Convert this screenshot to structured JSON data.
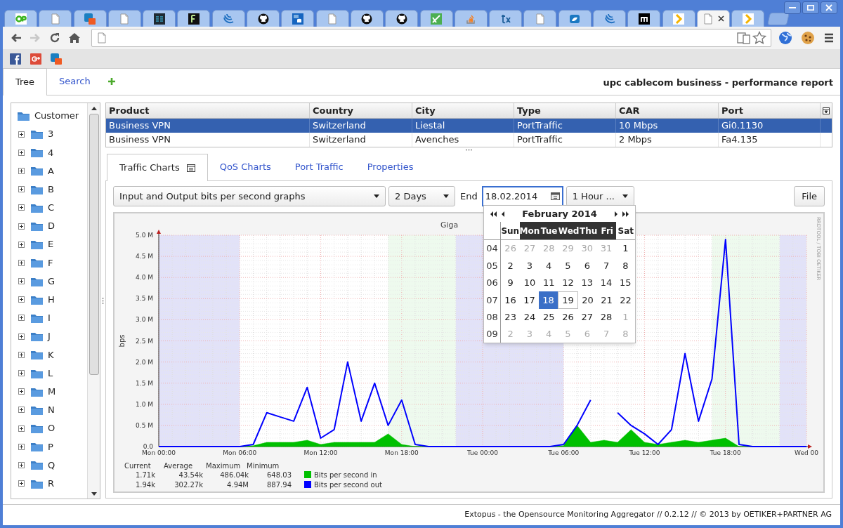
{
  "browser": {
    "tabs": [
      {
        "kind": "op",
        "selected": false
      },
      {
        "kind": "doc",
        "selected": false
      },
      {
        "kind": "z",
        "selected": false
      },
      {
        "kind": "doc",
        "selected": false
      },
      {
        "kind": "ss",
        "selected": false
      },
      {
        "kind": "f",
        "selected": false
      },
      {
        "kind": "jquery",
        "selected": false
      },
      {
        "kind": "github",
        "selected": false
      },
      {
        "kind": "db",
        "selected": false
      },
      {
        "kind": "doc",
        "selected": false
      },
      {
        "kind": "github",
        "selected": false
      },
      {
        "kind": "github",
        "selected": false
      },
      {
        "kind": "green",
        "selected": false
      },
      {
        "kind": "so",
        "selected": false
      },
      {
        "kind": "tx",
        "selected": false
      },
      {
        "kind": "doc",
        "selected": false
      },
      {
        "kind": "bird",
        "selected": false
      },
      {
        "kind": "jquery",
        "selected": false
      },
      {
        "kind": "m",
        "selected": false
      },
      {
        "kind": "arrow",
        "selected": false
      },
      {
        "kind": "doc",
        "selected": true
      },
      {
        "kind": "arrow",
        "selected": false
      }
    ],
    "nav_buttons": [
      {
        "kind": "back",
        "disabled": false
      },
      {
        "kind": "forward",
        "disabled": true
      },
      {
        "kind": "reload",
        "disabled": false
      },
      {
        "kind": "home",
        "disabled": false
      }
    ],
    "bookmarks": [
      {
        "kind": "facebook"
      },
      {
        "kind": "gplus"
      },
      {
        "kind": "z"
      }
    ]
  },
  "app": {
    "tabs": [
      {
        "label": "Tree",
        "selected": true
      },
      {
        "label": "Search",
        "selected": false
      }
    ],
    "title": "upc cablecom business - performance report",
    "tree": {
      "label": "Customer",
      "children": [
        {
          "label": "3",
          "expanded": false
        },
        {
          "label": "4",
          "expanded": false
        },
        {
          "label": "A",
          "expanded": false
        },
        {
          "label": "B",
          "expanded": false
        },
        {
          "label": "C",
          "expanded": false
        },
        {
          "label": "D",
          "expanded": false
        },
        {
          "label": "E",
          "expanded": false
        },
        {
          "label": "F",
          "expanded": false
        },
        {
          "label": "G",
          "expanded": false
        },
        {
          "label": "H",
          "expanded": false
        },
        {
          "label": "I",
          "expanded": false
        },
        {
          "label": "J",
          "expanded": false
        },
        {
          "label": "K",
          "expanded": false
        },
        {
          "label": "L",
          "expanded": false
        },
        {
          "label": "M",
          "expanded": false
        },
        {
          "label": "N",
          "expanded": false
        },
        {
          "label": "O",
          "expanded": false
        },
        {
          "label": "P",
          "expanded": false
        },
        {
          "label": "Q",
          "expanded": false
        },
        {
          "label": "R",
          "expanded": false
        }
      ]
    },
    "table": {
      "columns": [
        "Product",
        "Country",
        "City",
        "Type",
        "CAR",
        "Port"
      ],
      "rows": [
        {
          "cells": [
            "Business VPN",
            "Switzerland",
            "Liestal",
            "PortTraffic",
            "10 Mbps",
            "Gi0.1130"
          ],
          "selected": true
        },
        {
          "cells": [
            "Business VPN",
            "Switzerland",
            "Avenches",
            "PortTraffic",
            "2 Mbps",
            "Fa4.135"
          ],
          "selected": false
        }
      ]
    },
    "view_tabs": [
      {
        "label": "Traffic Charts",
        "selected": true
      },
      {
        "label": "QoS Charts",
        "selected": false
      },
      {
        "label": "Port Traffic",
        "selected": false
      },
      {
        "label": "Properties",
        "selected": false
      }
    ],
    "toolbar": {
      "graph_select": "Input and Output bits per second graphs",
      "range_select": "2 Days",
      "end_label": "End",
      "end_date": "18.02.2014",
      "step_select": "1 Hour ...",
      "file_button": "File"
    },
    "chart": {
      "credit": "RRDTOOL / TOBI OETIKER",
      "chart_data": {
        "type": "line",
        "title": "Giga",
        "ylabel": "bps",
        "grid": true,
        "legend": "bottom",
        "categories": [
          "Mon 00:00",
          null,
          null,
          null,
          null,
          null,
          "Mon 06:00",
          null,
          null,
          null,
          null,
          null,
          "Mon 12:00",
          null,
          null,
          null,
          null,
          null,
          "Mon 18:00",
          null,
          null,
          null,
          null,
          null,
          "Tue 00:00",
          null,
          null,
          null,
          null,
          null,
          "Tue 06:00",
          null,
          null,
          null,
          null,
          null,
          "Tue 12:00",
          null,
          null,
          null,
          null,
          null,
          "Tue 18:00",
          null,
          null,
          null,
          null,
          null,
          "Wed 00"
        ],
        "ylim": [
          0,
          5
        ],
        "yticks": [
          {
            "value": 0,
            "label": "0.0"
          },
          {
            "value": 0.5,
            "label": "0.5 M"
          },
          {
            "value": 1,
            "label": "1.0 M"
          },
          {
            "value": 1.5,
            "label": "1.5 M"
          },
          {
            "value": 2,
            "label": "2.0 M"
          },
          {
            "value": 2.5,
            "label": "2.5 M"
          },
          {
            "value": 3,
            "label": "3.0 M"
          },
          {
            "value": 3.5,
            "label": "3.5 M"
          },
          {
            "value": 4,
            "label": "4.0 M"
          },
          {
            "value": 4.5,
            "label": "4.5 M"
          },
          {
            "value": 5,
            "label": "5.0 M"
          }
        ],
        "series": [
          {
            "name": "Bits per second in",
            "type": "area",
            "color": "#00c000",
            "values": [
              0,
              0,
              0,
              0,
              0,
              0,
              0,
              0.02,
              0.1,
              0.1,
              0.1,
              0.15,
              0.05,
              0.1,
              0.1,
              0.1,
              0.1,
              0.3,
              0.05,
              0,
              0,
              0,
              0,
              0,
              0,
              0,
              0,
              0,
              0,
              0,
              0.02,
              0.5,
              0.1,
              0.15,
              0.1,
              0.4,
              0.1,
              0.05,
              0.1,
              0.15,
              0.1,
              0.15,
              0.2,
              0,
              0,
              0,
              0,
              0,
              0
            ]
          },
          {
            "name": "Bits per second out",
            "type": "line",
            "color": "#0000ff",
            "values": [
              0,
              0,
              0,
              0,
              0,
              0,
              0,
              0.05,
              0.8,
              0.7,
              0.6,
              1.4,
              0.2,
              0.4,
              2.0,
              0.6,
              1.5,
              0.5,
              1.1,
              0.05,
              0,
              0,
              0,
              0,
              0,
              0,
              0,
              0,
              0,
              0,
              0.05,
              0.5,
              1.1,
              null,
              0.8,
              0.5,
              0.3,
              0.05,
              0.4,
              2.2,
              0.6,
              1.6,
              4.9,
              0.05,
              0,
              0,
              0,
              0,
              0
            ]
          }
        ]
      },
      "legend": {
        "columns": [
          "Current",
          "Average",
          "Maximum",
          "Minimum"
        ],
        "rows": [
          {
            "values": [
              "1.71k",
              "43.54k",
              "486.04k",
              "648.03"
            ]
          },
          {
            "values": [
              "1.94k",
              "302.27k",
              "4.94M",
              "887.94"
            ]
          }
        ]
      }
    },
    "calendar": {
      "month": "February 2014",
      "weekdays": [
        {
          "label": "Sun",
          "weekend": true
        },
        {
          "label": "Mon",
          "weekend": false
        },
        {
          "label": "Tue",
          "weekend": false
        },
        {
          "label": "Wed",
          "weekend": false
        },
        {
          "label": "Thu",
          "weekend": false
        },
        {
          "label": "Fri",
          "weekend": false
        },
        {
          "label": "Sat",
          "weekend": true
        }
      ],
      "weeks": [
        {
          "number": "04",
          "days": [
            {
              "label": "26",
              "other_month": true,
              "selected": false,
              "today": false
            },
            {
              "label": "27",
              "other_month": true,
              "selected": false,
              "today": false
            },
            {
              "label": "28",
              "other_month": true,
              "selected": false,
              "today": false
            },
            {
              "label": "29",
              "other_month": true,
              "selected": false,
              "today": false
            },
            {
              "label": "30",
              "other_month": true,
              "selected": false,
              "today": false
            },
            {
              "label": "31",
              "other_month": true,
              "selected": false,
              "today": false
            },
            {
              "label": "1",
              "other_month": false,
              "selected": false,
              "today": false
            }
          ]
        },
        {
          "number": "05",
          "days": [
            {
              "label": "2",
              "other_month": false,
              "selected": false,
              "today": false
            },
            {
              "label": "3",
              "other_month": false,
              "selected": false,
              "today": false
            },
            {
              "label": "4",
              "other_month": false,
              "selected": false,
              "today": false
            },
            {
              "label": "5",
              "other_month": false,
              "selected": false,
              "today": false
            },
            {
              "label": "6",
              "other_month": false,
              "selected": false,
              "today": false
            },
            {
              "label": "7",
              "other_month": false,
              "selected": false,
              "today": false
            },
            {
              "label": "8",
              "other_month": false,
              "selected": false,
              "today": false
            }
          ]
        },
        {
          "number": "06",
          "days": [
            {
              "label": "9",
              "other_month": false,
              "selected": false,
              "today": false
            },
            {
              "label": "10",
              "other_month": false,
              "selected": false,
              "today": false
            },
            {
              "label": "11",
              "other_month": false,
              "selected": false,
              "today": false
            },
            {
              "label": "12",
              "other_month": false,
              "selected": false,
              "today": false
            },
            {
              "label": "13",
              "other_month": false,
              "selected": false,
              "today": false
            },
            {
              "label": "14",
              "other_month": false,
              "selected": false,
              "today": false
            },
            {
              "label": "15",
              "other_month": false,
              "selected": false,
              "today": false
            }
          ]
        },
        {
          "number": "07",
          "days": [
            {
              "label": "16",
              "other_month": false,
              "selected": false,
              "today": false
            },
            {
              "label": "17",
              "other_month": false,
              "selected": false,
              "today": false
            },
            {
              "label": "18",
              "other_month": false,
              "selected": true,
              "today": false
            },
            {
              "label": "19",
              "other_month": false,
              "selected": false,
              "today": true
            },
            {
              "label": "20",
              "other_month": false,
              "selected": false,
              "today": false
            },
            {
              "label": "21",
              "other_month": false,
              "selected": false,
              "today": false
            },
            {
              "label": "22",
              "other_month": false,
              "selected": false,
              "today": false
            }
          ]
        },
        {
          "number": "08",
          "days": [
            {
              "label": "23",
              "other_month": false,
              "selected": false,
              "today": false
            },
            {
              "label": "24",
              "other_month": false,
              "selected": false,
              "today": false
            },
            {
              "label": "25",
              "other_month": false,
              "selected": false,
              "today": false
            },
            {
              "label": "26",
              "other_month": false,
              "selected": false,
              "today": false
            },
            {
              "label": "27",
              "other_month": false,
              "selected": false,
              "today": false
            },
            {
              "label": "28",
              "other_month": false,
              "selected": false,
              "today": false
            },
            {
              "label": "1",
              "other_month": true,
              "selected": false,
              "today": false
            }
          ]
        },
        {
          "number": "09",
          "days": [
            {
              "label": "2",
              "other_month": true,
              "selected": false,
              "today": false
            },
            {
              "label": "3",
              "other_month": true,
              "selected": false,
              "today": false
            },
            {
              "label": "4",
              "other_month": true,
              "selected": false,
              "today": false
            },
            {
              "label": "5",
              "other_month": true,
              "selected": false,
              "today": false
            },
            {
              "label": "6",
              "other_month": true,
              "selected": false,
              "today": false
            },
            {
              "label": "7",
              "other_month": true,
              "selected": false,
              "today": false
            },
            {
              "label": "8",
              "other_month": true,
              "selected": false,
              "today": false
            }
          ]
        }
      ]
    },
    "footer": "Extopus - the Opensource Monitoring Aggregator // 0.2.12 // © 2013 by OETIKER+PARTNER AG"
  }
}
